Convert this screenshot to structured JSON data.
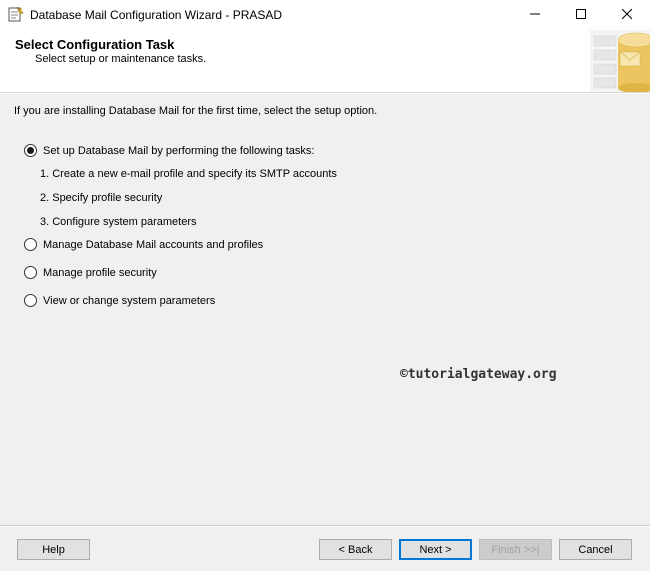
{
  "window": {
    "title": "Database Mail Configuration Wizard - PRASAD",
    "icons": {
      "app": "wizard-icon",
      "minimize": "minimize-icon",
      "maximize": "maximize-icon",
      "close": "close-icon"
    }
  },
  "header": {
    "title": "Select Configuration Task",
    "subtitle": "Select setup or maintenance tasks.",
    "graphic": "database-banner-graphic"
  },
  "body": {
    "intro": "If you are installing Database Mail for the first time, select the setup option.",
    "options": [
      {
        "label": "Set up Database Mail by performing the following tasks:",
        "selected": true
      },
      {
        "label": "Manage Database Mail accounts and profiles",
        "selected": false
      },
      {
        "label": "Manage profile security",
        "selected": false
      },
      {
        "label": "View or change system parameters",
        "selected": false
      }
    ],
    "setup_steps": [
      "1. Create a new e-mail profile and specify its SMTP accounts",
      "2. Specify profile security",
      "3. Configure system parameters"
    ],
    "watermark": "©tutorialgateway.org"
  },
  "footer": {
    "help": "Help",
    "back": "< Back",
    "next": "Next >",
    "finish": "Finish >>|",
    "cancel": "Cancel"
  },
  "colors": {
    "accent": "#0078d7",
    "background": "#f0f0f0",
    "header": "#ffffff"
  }
}
